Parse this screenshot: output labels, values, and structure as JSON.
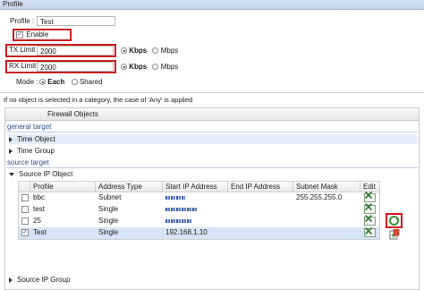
{
  "window": {
    "title": "Profile"
  },
  "profile": {
    "label": "Profile :",
    "value": "Test",
    "enable_label": "Enable",
    "enable_checked": true
  },
  "tx": {
    "label": "TX Limit :",
    "value": "2000",
    "opt1": "Kbps",
    "opt2": "Mbps",
    "selected": "Kbps"
  },
  "rx": {
    "label": "RX Limit :",
    "value": "2000",
    "opt1": "Kbps",
    "opt2": "Mbps",
    "selected": "Kbps"
  },
  "mode": {
    "label": "Mode :",
    "opt1": "Each",
    "opt2": "Shared",
    "selected": "Each"
  },
  "note": "If no object is selected in a category, the case of 'Any' is applied",
  "fw_header": "Firewall Objects",
  "general_target": {
    "title": "general target",
    "items": [
      "Time Object",
      "Time Group"
    ]
  },
  "source_target": {
    "title": "source target",
    "object_label": "Source IP Object",
    "group_label": "Source IP Group"
  },
  "table": {
    "headers": [
      "Profile",
      "Address Type",
      "Start IP Address",
      "End IP Address",
      "Subnet Mask",
      "Edit"
    ],
    "rows": [
      {
        "checked": false,
        "profile": "bbc",
        "type": "Subnet",
        "start": "",
        "end": "",
        "mask": "255.255.255.0",
        "selected": false
      },
      {
        "checked": false,
        "profile": "test",
        "type": "Single",
        "start": "",
        "end": "",
        "mask": "",
        "selected": false
      },
      {
        "checked": false,
        "profile": "25",
        "type": "Single",
        "start": "",
        "end": "",
        "mask": "",
        "selected": false
      },
      {
        "checked": true,
        "profile": "Test",
        "type": "Single",
        "start": "192.168.1.10",
        "end": "",
        "mask": "",
        "selected": true
      }
    ]
  },
  "colors": {
    "accent_red": "#cc1d1d",
    "selected_row": "#d6e4f7",
    "group_header": "#2f4f90"
  }
}
